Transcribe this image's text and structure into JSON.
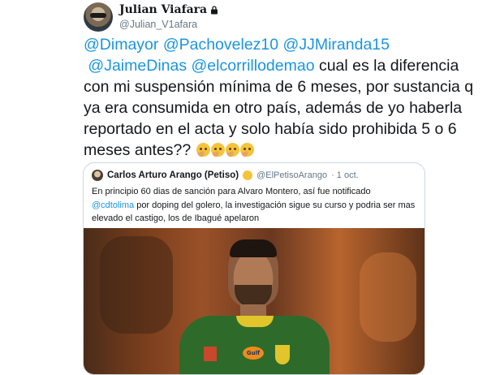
{
  "tweet": {
    "author_name": "Julian Viafara",
    "author_handle": "@Julian_V1afara",
    "mentions_line1": [
      "@Dimayor",
      "@Pachovelez10",
      "@JJMiranda15"
    ],
    "mentions_line2": [
      "@JaimeDinas",
      "@elcorrillodemao"
    ],
    "line2_text": " cual es la diferencia",
    "line3": "con mi suspensión mínima de 6 meses, por sustancia q",
    "line4": "ya era consumida en otro país, además de yo haberla",
    "line5": "reportado en el acta y solo había sido prohibida 5 o 6",
    "line6": "meses antes??",
    "emoji": "thinking-face-emoji"
  },
  "quoted_tweet": {
    "author_name": "Carlos Arturo Arango (Petiso)",
    "author_handle": "@ElPetisoArango",
    "date": "· 1 oct.",
    "text_line1": "En principio 60 dias de sanción  para Alvaro Montero, así fue notificado",
    "mention": "@cdtolima",
    "text_line2": " por doping del golero, la investigación sigue su curso y podria ser mas",
    "text_line3": "elevado el castigo, los de Ibagué apelaron",
    "photo_sponsor_text": "Gulf"
  },
  "colors": {
    "mention": "#1b95e0",
    "text": "#14171a",
    "secondary": "#657786",
    "border": "#ccd6dd"
  }
}
